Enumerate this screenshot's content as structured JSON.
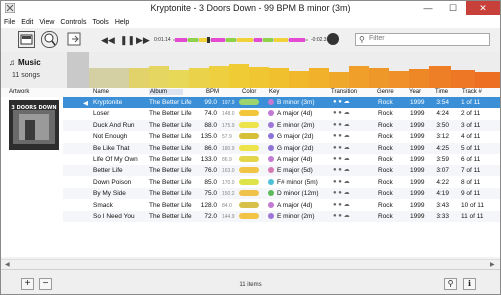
{
  "window": {
    "title": "Kryptonite - 3 Doors Down - 99 BPM B minor (3m)",
    "minimize": "—",
    "maximize": "☐",
    "close": "✕"
  },
  "menu": [
    "File",
    "Edit",
    "View",
    "Controls",
    "Tools",
    "Help"
  ],
  "player": {
    "elapsed": "0:01.14",
    "remaining": "-0:02.39",
    "search_placeholder": "Filter"
  },
  "header": {
    "title": "Music",
    "count": "11 songs",
    "bar_colors": [
      "#c7c7c7",
      "#cfcfa6",
      "#e6d75b",
      "#f1c62d",
      "#f3b12b",
      "#f09a2a",
      "#ef8d2a",
      "#ee7a25"
    ]
  },
  "columns": [
    "Artwork",
    "Name",
    "Album",
    "BPM",
    "Color",
    "Key",
    "Transition",
    "Genre",
    "Year",
    "Time",
    "Track #"
  ],
  "album_art_text": "3 DOORS DOWN",
  "songs": [
    {
      "name": "Kryptonite",
      "album": "The Better Life",
      "bpm": "99.0",
      "energy": "197.9",
      "color": "#9dd46d",
      "key": "B minor (3m)",
      "keycolor": "#c57ad0",
      "genre": "Rock",
      "year": "1999",
      "time": "3:54",
      "track": "1 of 11"
    },
    {
      "name": "Loser",
      "album": "The Better Life",
      "bpm": "74.0",
      "energy": "148.0",
      "color": "#f3c53a",
      "key": "A major (4d)",
      "keycolor": "#c27ad3",
      "genre": "Rock",
      "year": "1999",
      "time": "4:24",
      "track": "2 of 11"
    },
    {
      "name": "Duck And Run",
      "album": "The Better Life",
      "bpm": "88.0",
      "energy": "175.9",
      "color": "#ece44a",
      "key": "E minor (2m)",
      "keycolor": "#9e76d8",
      "genre": "Rock",
      "year": "1999",
      "time": "3:50",
      "track": "3 of 11"
    },
    {
      "name": "Not Enough",
      "album": "The Better Life",
      "bpm": "135.0",
      "energy": "57.9",
      "color": "#d6c03a",
      "key": "G major (2d)",
      "keycolor": "#8d74d6",
      "genre": "Rock",
      "year": "1999",
      "time": "3:12",
      "track": "4 of 11"
    },
    {
      "name": "Be Like That",
      "album": "The Better Life",
      "bpm": "86.0",
      "energy": "180.9",
      "color": "#ece44a",
      "key": "G major (2d)",
      "keycolor": "#8d74d6",
      "genre": "Rock",
      "year": "1999",
      "time": "4:25",
      "track": "5 of 11"
    },
    {
      "name": "Life Of My Own",
      "album": "The Better Life",
      "bpm": "133.0",
      "energy": "86.9",
      "color": "#e3d64a",
      "key": "A major (4d)",
      "keycolor": "#c27ad3",
      "genre": "Rock",
      "year": "1999",
      "time": "3:59",
      "track": "6 of 11"
    },
    {
      "name": "Better Life",
      "album": "The Better Life",
      "bpm": "76.0",
      "energy": "163.0",
      "color": "#f1c445",
      "key": "E major (5d)",
      "keycolor": "#d67ab3",
      "genre": "Rock",
      "year": "1999",
      "time": "3:07",
      "track": "7 of 11"
    },
    {
      "name": "Down Poison",
      "album": "The Better Life",
      "bpm": "85.0",
      "energy": "170.0",
      "color": "#dfe34a",
      "key": "F# minor (5m)",
      "keycolor": "#4fc0d8",
      "genre": "Rock",
      "year": "1999",
      "time": "4:22",
      "track": "8 of 11"
    },
    {
      "name": "By My Side",
      "album": "The Better Life",
      "bpm": "75.0",
      "energy": "150.2",
      "color": "#f0c24a",
      "key": "D minor (12m)",
      "keycolor": "#5fb95a",
      "genre": "Rock",
      "year": "1999",
      "time": "4:19",
      "track": "9 of 11"
    },
    {
      "name": "Smack",
      "album": "The Better Life",
      "bpm": "128.0",
      "energy": "84.0",
      "color": "#d7c14a",
      "key": "A major (4d)",
      "keycolor": "#c27ad3",
      "genre": "Rock",
      "year": "1999",
      "time": "3:43",
      "track": "10 of 11"
    },
    {
      "name": "So I Need You",
      "album": "The Better Life",
      "bpm": "72.0",
      "energy": "144.9",
      "color": "#f1c445",
      "key": "E minor (2m)",
      "keycolor": "#9e76d8",
      "genre": "Rock",
      "year": "1999",
      "time": "3:33",
      "track": "11 of 11"
    }
  ],
  "status": {
    "count": "11 items"
  }
}
